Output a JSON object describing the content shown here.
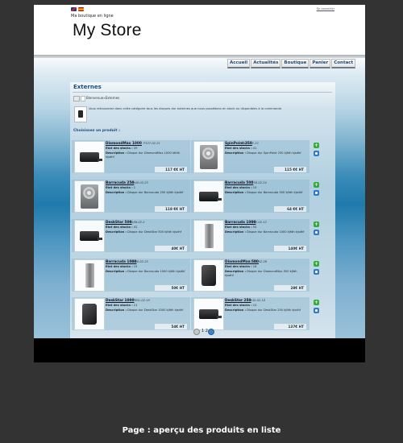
{
  "header": {
    "tagline": "Ma boutique en ligne",
    "logo": "My Store",
    "login_link": "Se connecter",
    "flags": [
      "english-flag-icon",
      "spanish-flag-icon"
    ]
  },
  "nav": {
    "items": [
      "Accueil",
      "Actualités",
      "Boutique",
      "Panier",
      "Contact"
    ]
  },
  "category": {
    "title": "Externes",
    "breadcrumb": "Bienvenue»Externes",
    "description": "Vous retrouverez dans cette catégorie tous les disques dur externes que nous possédons en stock ou disponibles à la commande.",
    "choose_label": "Choisissez un produit :"
  },
  "labels": {
    "stock": "Etat des stocks :",
    "description": "Description :"
  },
  "products": [
    {
      "name": "DiamondMax 1000",
      "ref": "P327-02-21",
      "stock": "39",
      "desc": "Disque dur DiamondMax 1000 ldfdh kjsdhf",
      "price": "117 €€ HT",
      "image": "black-drive"
    },
    {
      "name": "SpinPoint 250",
      "ref": "P470-02-22",
      "stock": "41",
      "desc": "Disque dur SpinPoint 250 kjfdh kjsdhf",
      "price": "115 €€ HT",
      "image": "bare-drive"
    },
    {
      "name": "Barracuda 250",
      "ref": "P948-02-23",
      "stock": "1",
      "desc": "Disque dur Barracuda 250 kjfdh kjsdhf",
      "price": "118 €€ HT",
      "image": "bare-drive"
    },
    {
      "name": "Barracuda 500",
      "ref": "P238-02-24",
      "stock": "10",
      "desc": "Disque dur Barracuda 500 kjfdh kjsdhf",
      "price": "64 €€ HT",
      "image": "black-drive"
    },
    {
      "name": "DeskStar 500",
      "ref": "P486-02-2",
      "stock": "41",
      "desc": "Disque dur DeskStar 500 kjfdh kjsdhf",
      "price": "40€ HT",
      "image": "black-drive"
    },
    {
      "name": "Barracuda 1000",
      "ref": "P162-02-12",
      "stock": "50",
      "desc": "Disque dur Barracuda 1000 kjfdh kjsdhf",
      "price": "140€ HT",
      "image": "tower-drive"
    },
    {
      "name": "Barracuda 1000",
      "ref": "P568-02-25",
      "stock": "15",
      "desc": "Disque dur Barracuda 1000 kjfdh kjsdhf",
      "price": "50€ HT",
      "image": "tower-drive"
    },
    {
      "name": "DiamondMax 500",
      "ref": "P1105-02-26",
      "stock": "16",
      "desc": "Disque dur DiamondMax 500 kjfdh kjsdhf",
      "price": "28€ HT",
      "image": "slab-drive"
    },
    {
      "name": "DeskStar 1000",
      "ref": "P901-02-19",
      "stock": "21",
      "desc": "Disque dur DeskStar 1000 kjfdh kjsdhf",
      "price": "54€ HT",
      "image": "slab-drive"
    },
    {
      "name": "DeskStar 250",
      "ref": "P1145-02-18",
      "stock": "10",
      "desc": "Disque dur DeskStar 250 kjfdh kjsdhf",
      "price": "137€ HT",
      "image": "black-drive"
    }
  ],
  "pager": {
    "page": "1 2"
  },
  "caption": "Page : aperçu des produits en liste"
}
